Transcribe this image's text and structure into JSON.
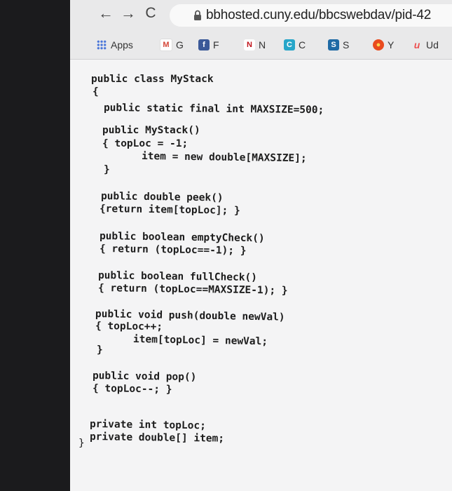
{
  "browser": {
    "url": "bbhosted.cuny.edu/bbcswebdav/pid-42",
    "nav": {
      "back": "←",
      "forward": "→",
      "reload": "C"
    }
  },
  "bookmarks": {
    "apps_label": "Apps",
    "items": [
      {
        "label": "G",
        "icon": "gmail-icon",
        "color": "#d44638",
        "glyph": "M"
      },
      {
        "label": "F",
        "icon": "facebook-icon",
        "color": "#3b5998",
        "glyph": "f"
      },
      {
        "label": "N",
        "icon": "netflix-icon",
        "color": "#c0141b",
        "glyph": "N"
      },
      {
        "label": "C",
        "icon": "c-icon",
        "color": "#27a6c9",
        "glyph": "C"
      },
      {
        "label": "S",
        "icon": "s-icon",
        "color": "#1f6aa5",
        "glyph": "S"
      },
      {
        "label": "Y",
        "icon": "y-icon",
        "color": "#e94b1e",
        "glyph": "●"
      },
      {
        "label": "Ud",
        "icon": "udemy-icon",
        "color": "#ec5252",
        "glyph": "u"
      }
    ]
  },
  "code": {
    "lines": [
      "public class MyStack",
      "{",
      "public static final int MAXSIZE=500;",
      "public MyStack()",
      "{ topLoc = -1;",
      "item = new double[MAXSIZE];",
      "}",
      "public double peek()",
      "{return item[topLoc]; }",
      "public boolean emptyCheck()",
      "{ return (topLoc==-1); }",
      "public boolean fullCheck()",
      "{ return (topLoc==MAXSIZE-1); }",
      "public void push(double newVal)",
      "{ topLoc++;",
      "item[topLoc] = newVal;",
      "}",
      "public void pop()",
      "{ topLoc--; }",
      "private int topLoc;",
      "private double[] item;",
      "}"
    ]
  }
}
